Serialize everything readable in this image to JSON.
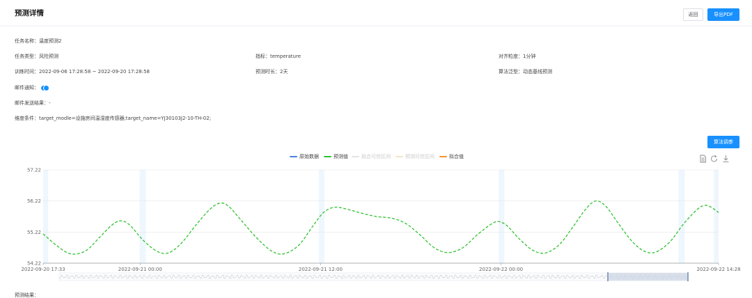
{
  "header": {
    "title": "预测详情",
    "back_label": "返回",
    "export_label": "导出PDF"
  },
  "info": {
    "task_name_label": "任务名称：",
    "task_name": "温度预测2",
    "task_type_label": "任务类型：",
    "task_type": "风险预测",
    "metric_label": "指标：",
    "metric": "temperature",
    "align_label": "对齐粒度：",
    "align": "1分钟",
    "train_time_label": "训练时间：",
    "train_time": "2022-09-06 17:28:58 ~ 2022-09-20 17:28:58",
    "predict_len_label": "预测时长：",
    "predict_len": "2天",
    "algo_label": "算法泛型：",
    "algo": "动态基线预测",
    "email_label": "邮件通知：",
    "email_result_label": "邮件发送结果：",
    "email_result": "-",
    "dimension_label": "维度条件：",
    "dimension": "target_modle=设施房间温湿度传感器;target_name=YJ30103J2-10-TH-02;"
  },
  "adjust_label": "算法调参",
  "legend": [
    {
      "label": "原始数据",
      "color": "#4a7fe0",
      "active": true
    },
    {
      "label": "预测值",
      "color": "#2fc22f",
      "active": true
    },
    {
      "label": "拟合可信区间",
      "color": "#d9d9d9",
      "active": false
    },
    {
      "label": "预测可信区间",
      "color": "#f3e6c4",
      "active": false
    },
    {
      "label": "拟合值",
      "color": "#f5932a",
      "active": true
    }
  ],
  "tools": [
    "document-icon",
    "refresh-icon",
    "download-icon"
  ],
  "chart_data": {
    "type": "line",
    "ylim": [
      54.22,
      57.22
    ],
    "yticks": [
      "57.22",
      "56.22",
      "55.22",
      "54.22"
    ],
    "xlim": [
      "2022-09-20 17:33",
      "2022-09-22 14:28"
    ],
    "xticks": [
      {
        "t": 0,
        "label": "2022-09-20 17:33"
      },
      {
        "t": 387,
        "label": "2022-09-21 00:00"
      },
      {
        "t": 1107,
        "label": "2022-09-21 12:00"
      },
      {
        "t": 1827,
        "label": "2022-09-22 00:00"
      },
      {
        "t": 2695,
        "label": "2022-09-22 14:28"
      }
    ],
    "band_regions": [
      [
        0,
        20
      ],
      [
        385,
        410
      ],
      [
        1100,
        1122
      ],
      [
        1818,
        1840
      ],
      [
        2535,
        2560
      ],
      [
        2676,
        2695
      ]
    ],
    "series": [
      {
        "name": "预测值",
        "color": "#2fc22f",
        "dashed": true,
        "points": [
          [
            0,
            55.16
          ],
          [
            55,
            54.78
          ],
          [
            110,
            54.52
          ],
          [
            170,
            54.62
          ],
          [
            225,
            55.05
          ],
          [
            275,
            55.45
          ],
          [
            310,
            55.58
          ],
          [
            345,
            55.45
          ],
          [
            400,
            54.95
          ],
          [
            455,
            54.6
          ],
          [
            500,
            54.55
          ],
          [
            550,
            54.85
          ],
          [
            610,
            55.45
          ],
          [
            665,
            55.95
          ],
          [
            705,
            56.15
          ],
          [
            740,
            56.05
          ],
          [
            790,
            55.6
          ],
          [
            850,
            55.05
          ],
          [
            910,
            54.62
          ],
          [
            960,
            54.52
          ],
          [
            1020,
            54.8
          ],
          [
            1075,
            55.4
          ],
          [
            1120,
            55.86
          ],
          [
            1165,
            56.02
          ],
          [
            1215,
            55.95
          ],
          [
            1270,
            55.83
          ],
          [
            1330,
            55.72
          ],
          [
            1395,
            55.66
          ],
          [
            1450,
            55.48
          ],
          [
            1505,
            55.12
          ],
          [
            1560,
            54.72
          ],
          [
            1615,
            54.56
          ],
          [
            1675,
            54.72
          ],
          [
            1730,
            55.12
          ],
          [
            1785,
            55.46
          ],
          [
            1815,
            55.56
          ],
          [
            1850,
            55.43
          ],
          [
            1900,
            55.0
          ],
          [
            1955,
            54.63
          ],
          [
            2005,
            54.55
          ],
          [
            2060,
            54.82
          ],
          [
            2115,
            55.4
          ],
          [
            2165,
            55.96
          ],
          [
            2205,
            56.22
          ],
          [
            2245,
            56.05
          ],
          [
            2295,
            55.5
          ],
          [
            2350,
            54.92
          ],
          [
            2400,
            54.6
          ],
          [
            2445,
            54.58
          ],
          [
            2500,
            54.9
          ],
          [
            2555,
            55.48
          ],
          [
            2610,
            55.95
          ],
          [
            2640,
            56.08
          ],
          [
            2665,
            56.02
          ],
          [
            2695,
            55.85
          ]
        ]
      }
    ]
  },
  "footer_label": "预测结果："
}
